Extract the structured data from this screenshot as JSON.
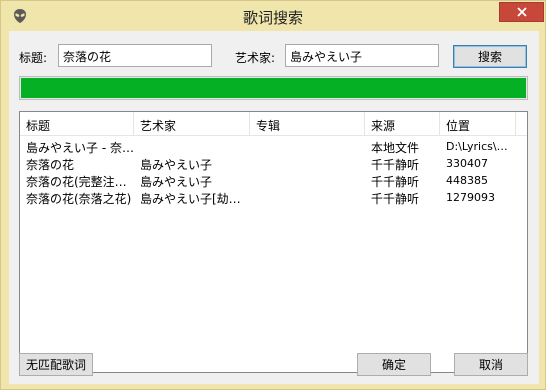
{
  "window": {
    "title": "歌词搜索"
  },
  "search": {
    "title_label": "标题:",
    "title_value": "奈落の花",
    "artist_label": "艺术家:",
    "artist_value": "島みやえい子",
    "search_button": "搜索"
  },
  "progress": {
    "value": 1.0,
    "color": "#06b025"
  },
  "results": {
    "columns": [
      "标题",
      "艺术家",
      "专辑",
      "来源",
      "位置"
    ],
    "rows": [
      {
        "title": "島みやえい子 - 奈…",
        "artist": "",
        "album": "",
        "source": "本地文件",
        "location": "D:\\Lyrics\\…"
      },
      {
        "title": "奈落の花",
        "artist": "島みやえい子",
        "album": "",
        "source": "千千静听",
        "location": "330407"
      },
      {
        "title": "奈落の花(完整注…",
        "artist": "島みやえい子",
        "album": "",
        "source": "千千静听",
        "location": "448385"
      },
      {
        "title": "奈落の花(奈落之花)",
        "artist": "島みやえい子[劫…",
        "album": "",
        "source": "千千静听",
        "location": "1279093"
      }
    ]
  },
  "footer": {
    "no_match_button": "无匹配歌词",
    "ok_button": "确定",
    "cancel_button": "取消"
  }
}
